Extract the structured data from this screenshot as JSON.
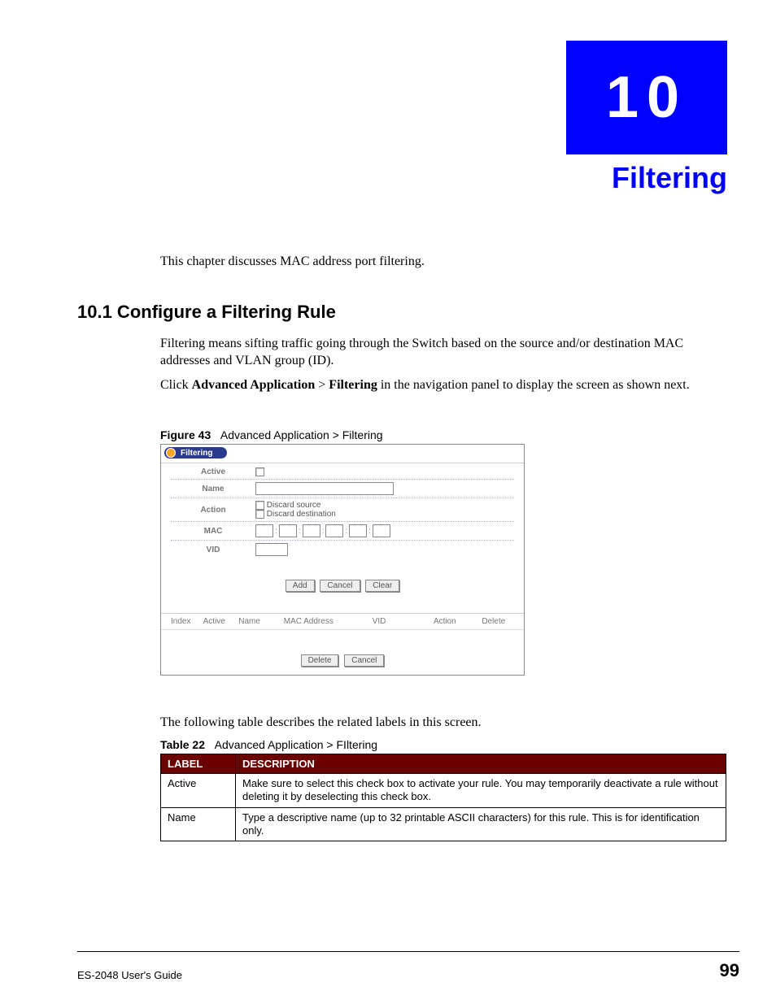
{
  "chapter": {
    "number": "10",
    "title": "Filtering"
  },
  "intro": "This chapter discusses MAC address port filtering.",
  "section": {
    "heading": "10.1  Configure a Filtering Rule",
    "body1": "Filtering means sifting traffic going through the Switch based on the source and/or destination MAC addresses and VLAN group (ID).",
    "body2_pre": "Click ",
    "body2_b1": "Advanced Application",
    "body2_mid": " > ",
    "body2_b2": "Filtering",
    "body2_post": " in the navigation panel to display the screen as shown next."
  },
  "figure": {
    "label": "Figure 43",
    "title": "Advanced Application > Filtering"
  },
  "screenshot": {
    "title": "Filtering",
    "labels": {
      "active": "Active",
      "name": "Name",
      "action": "Action",
      "mac": "MAC",
      "vid": "VID"
    },
    "action_opts": {
      "discard_src": "Discard source",
      "discard_dst": "Discard destination"
    },
    "buttons": {
      "add": "Add",
      "cancel": "Cancel",
      "clear": "Clear",
      "delete": "Delete"
    },
    "table_headers": {
      "index": "Index",
      "active": "Active",
      "name": "Name",
      "mac": "MAC Address",
      "vid": "VID",
      "action": "Action",
      "delete": "Delete"
    }
  },
  "post_figure": "The following table describes the related labels in this screen.",
  "table": {
    "label": "Table 22",
    "title": "Advanced Application > FIltering",
    "headers": {
      "label": "LABEL",
      "description": "DESCRIPTION"
    },
    "rows": [
      {
        "label": "Active",
        "desc": "Make sure to select this check box to activate your rule. You may temporarily deactivate a rule without deleting it by deselecting this check box."
      },
      {
        "label": "Name",
        "desc": "Type a descriptive name (up to 32 printable ASCII characters) for this rule. This is for identification only."
      }
    ]
  },
  "footer": {
    "guide": "ES-2048 User's Guide",
    "page": "99"
  }
}
